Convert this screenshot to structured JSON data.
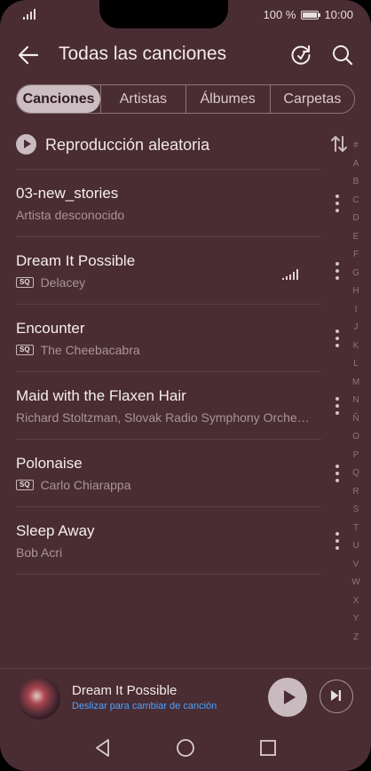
{
  "status": {
    "battery_text": "100 %",
    "time": "10:00"
  },
  "appbar": {
    "title": "Todas las canciones"
  },
  "tabs": [
    {
      "label": "Canciones",
      "active": true
    },
    {
      "label": "Artistas",
      "active": false
    },
    {
      "label": "Álbumes",
      "active": false
    },
    {
      "label": "Carpetas",
      "active": false
    }
  ],
  "shuffle": {
    "label": "Reproducción aleatoria"
  },
  "sq_badge": "SQ",
  "songs": [
    {
      "title": "03-new_stories",
      "subtitle": "Artista desconocido",
      "sq": false
    },
    {
      "title": "Dream It Possible",
      "subtitle": "Delacey",
      "sq": true,
      "playing": true
    },
    {
      "title": "Encounter",
      "subtitle": "The Cheebacabra",
      "sq": true
    },
    {
      "title": "Maid with the Flaxen Hair",
      "subtitle": "Richard Stoltzman, Slovak Radio Symphony Orche…",
      "sq": false
    },
    {
      "title": "Polonaise",
      "subtitle": "Carlo Chiarappa",
      "sq": true
    },
    {
      "title": "Sleep Away",
      "subtitle": "Bob Acri",
      "sq": false
    }
  ],
  "alphabet": [
    "#",
    "A",
    "B",
    "C",
    "D",
    "E",
    "F",
    "G",
    "H",
    "I",
    "J",
    "K",
    "L",
    "M",
    "N",
    "Ñ",
    "O",
    "P",
    "Q",
    "R",
    "S",
    "T",
    "U",
    "V",
    "W",
    "X",
    "Y",
    "Z"
  ],
  "now_playing": {
    "title": "Dream It Possible",
    "subtitle": "Deslizar para cambiar de canción"
  },
  "colors": {
    "background": "#4a2c33",
    "accent_blue": "#4aa3ff"
  }
}
